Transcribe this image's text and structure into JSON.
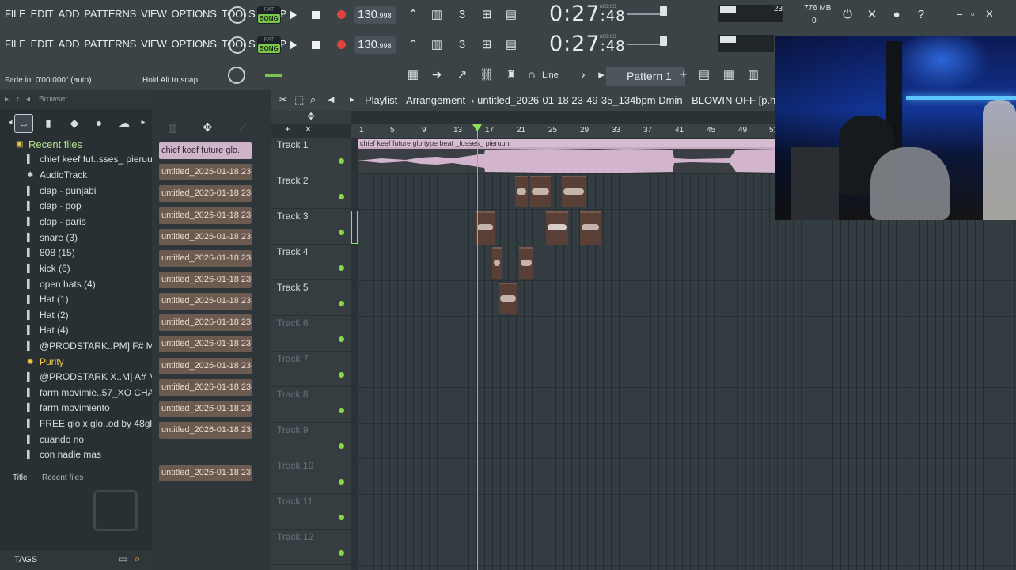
{
  "menu": [
    "FILE",
    "EDIT",
    "ADD",
    "PATTERNS",
    "VIEW",
    "OPTIONS",
    "TOOLS",
    "HELP"
  ],
  "transport": {
    "pat_label": "PAT",
    "song_label": "SONG",
    "tempo": "130",
    "tempo_frac": ".998",
    "time_main": "0:27",
    "time_sub": ":48",
    "time_unit": "M:S:CS"
  },
  "stats": {
    "cpu_value": "23",
    "memory": "776 MB",
    "voices": "0"
  },
  "row3": {
    "fade_in": "Fade in:  0'00.000\" (auto)",
    "snap_hint": "Hold Alt to snap",
    "draw_mode": "Line",
    "pattern_selector": "Pattern 1"
  },
  "browser": {
    "title": "Browser",
    "recent_header": "Recent files",
    "items": [
      {
        "label": "chief keef fut..sses_ pieruun",
        "icon": "audio-file-icon"
      },
      {
        "label": "AudioTrack",
        "icon": "gear-icon"
      },
      {
        "label": "clap - punjabi",
        "icon": "audio-file-icon"
      },
      {
        "label": "clap - pop",
        "icon": "audio-file-icon"
      },
      {
        "label": "clap - paris",
        "icon": "audio-file-icon"
      },
      {
        "label": "snare (3)",
        "icon": "audio-file-icon"
      },
      {
        "label": "808 (15)",
        "icon": "audio-file-icon"
      },
      {
        "label": "kick (6)",
        "icon": "audio-file-icon"
      },
      {
        "label": "open hats (4)",
        "icon": "audio-file-icon"
      },
      {
        "label": "Hat (1)",
        "icon": "audio-file-icon"
      },
      {
        "label": "Hat (2)",
        "icon": "audio-file-icon"
      },
      {
        "label": "Hat (4)",
        "icon": "audio-file-icon"
      },
      {
        "label": "@PRODSTARK..PM] F# Major",
        "icon": "audio-file-icon"
      },
      {
        "label": "Purity",
        "icon": "plugin-icon"
      },
      {
        "label": "@PRODSTARK X..M] A# Minor",
        "icon": "audio-file-icon"
      },
      {
        "label": "farm movimie..57_XO CHAIN",
        "icon": "audio-file-icon"
      },
      {
        "label": "farm movimiento",
        "icon": "audio-file-icon"
      },
      {
        "label": "FREE glo x glo..od by 48glock",
        "icon": "audio-file-icon"
      },
      {
        "label": "cuando no",
        "icon": "audio-file-icon"
      },
      {
        "label": "con nadie mas",
        "icon": "audio-file-icon"
      }
    ],
    "footer_title_label": "Title",
    "footer_title_value": "Recent files",
    "tags_label": "TAGS"
  },
  "patterns": [
    "chief keef future glo..",
    "untitled_2026-01-18 23-..",
    "untitled_2026-01-18 23-..",
    "untitled_2026-01-18 23-..",
    "untitled_2026-01-18 23-..",
    "untitled_2026-01-18 23-..",
    "untitled_2026-01-18 23-..",
    "untitled_2026-01-18 23-..",
    "untitled_2026-01-18 23-..",
    "untitled_2026-01-18 23-..",
    "untitled_2026-01-18 23-..",
    "untitled_2026-01-18 23-..",
    "untitled_2026-01-18 23-..",
    "untitled_2026-01-18 23-..",
    "untitled_2026-01-18 23-.."
  ],
  "playlist": {
    "title": "Playlist - Arrangement",
    "project": "untitled_2026-01-18 23-49-35_134bpm Dmin - BLOWIN OFF [p.hi",
    "ruler": [
      "1",
      "5",
      "9",
      "13",
      "17",
      "21",
      "25",
      "29",
      "33",
      "37",
      "41",
      "45",
      "49",
      "53"
    ],
    "tracks": [
      "Track 1",
      "Track 2",
      "Track 3",
      "Track 4",
      "Track 5",
      "Track 6",
      "Track 7",
      "Track 8",
      "Track 9",
      "Track 10",
      "Track 11",
      "Track 12"
    ],
    "audio_clip_label": "chief keef future glo type beat _losses_ pieruun"
  },
  "colors": {
    "accent_green": "#79c84b",
    "clip_pink": "#c9a8c2",
    "clip_brown": "#5a3f36",
    "record_red": "#e0413d"
  }
}
